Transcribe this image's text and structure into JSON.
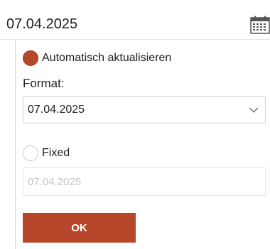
{
  "date_field": {
    "value": "07.04.2025",
    "icon": "calendar-icon"
  },
  "panel": {
    "auto_update": {
      "label": "Automatisch aktualisieren",
      "checked": true
    },
    "format": {
      "label": "Format:",
      "selected_value": "07.04.2025",
      "icon": "chevron-down-icon"
    },
    "fixed": {
      "label": "Fixed",
      "checked": false,
      "input_value": "07.04.2025"
    },
    "ok_label": "OK"
  },
  "colors": {
    "accent": "#b7472a",
    "text": "#222222",
    "disabled_text": "#c4c4c4",
    "border": "#d2d2d2"
  }
}
